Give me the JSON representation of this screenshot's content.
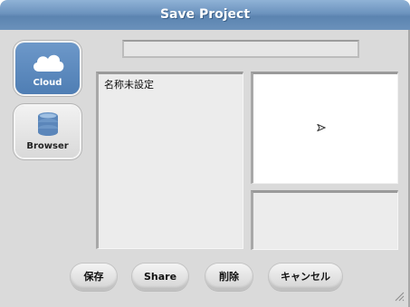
{
  "dialog": {
    "title": "Save Project"
  },
  "sources": [
    {
      "label": "Cloud",
      "icon": "cloud-icon",
      "selected": true
    },
    {
      "label": "Browser",
      "icon": "database-icon",
      "selected": false
    }
  ],
  "name_field": {
    "value": "",
    "placeholder": ""
  },
  "projects": [
    "名称未設定"
  ],
  "buttons": {
    "save": "保存",
    "share": "Share",
    "delete": "削除",
    "cancel": "キャンセル"
  },
  "colors": {
    "titlebar": "#6c93be",
    "selected_source": "#5b8ac0",
    "dialog_bg": "#dadada"
  }
}
